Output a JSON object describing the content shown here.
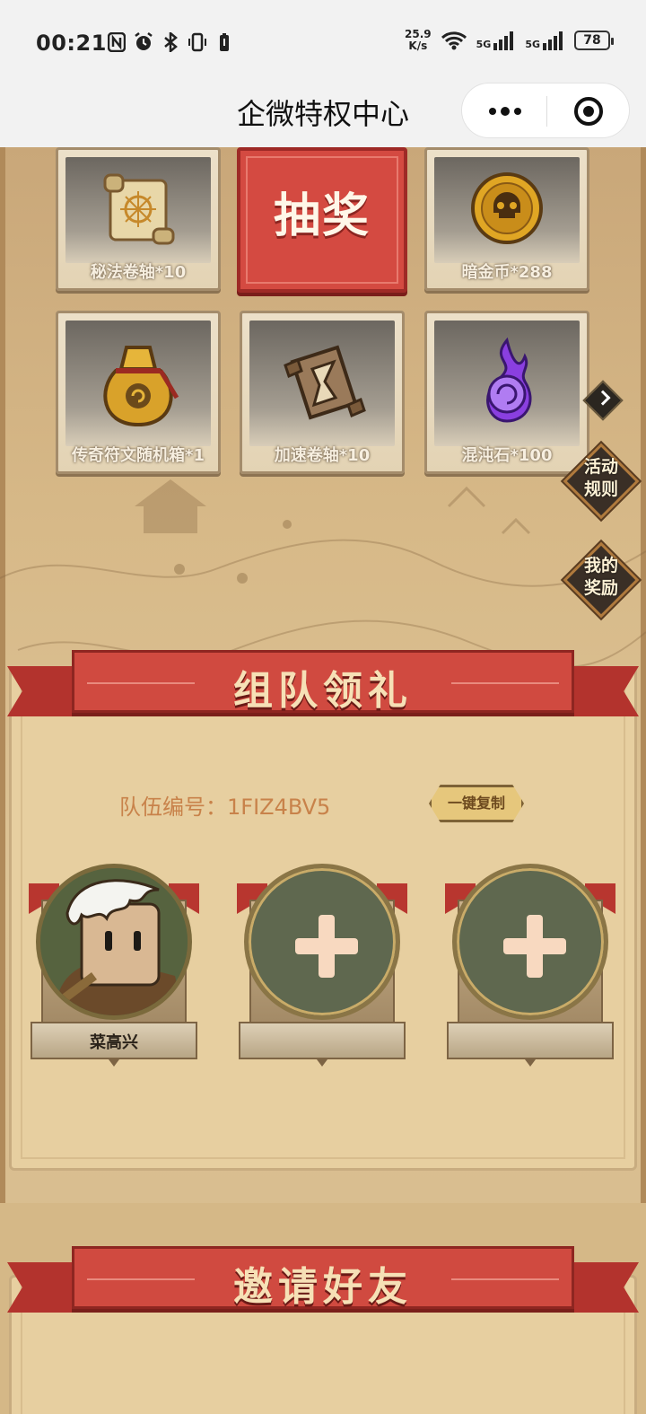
{
  "status_bar": {
    "time": "00:21",
    "speed_value": "25.9",
    "speed_unit": "K/s",
    "network_1": "5G",
    "network_2": "5G",
    "battery": "78"
  },
  "title_bar": {
    "title": "企微特权中心"
  },
  "rewards": {
    "draw_label": "抽奖",
    "items": [
      {
        "label": "秘法卷轴*10",
        "icon": "scroll-icon"
      },
      {
        "label": "暗金币*288",
        "icon": "skull-coin-icon"
      },
      {
        "label": "传奇符文随机箱*1",
        "icon": "rune-bag-icon"
      },
      {
        "label": "加速卷轴*10",
        "icon": "hourglass-scroll-icon"
      },
      {
        "label": "混沌石*100",
        "icon": "chaos-stone-icon"
      }
    ]
  },
  "side_buttons": {
    "rules_line1": "活动",
    "rules_line2": "规则",
    "rewards_line1": "我的",
    "rewards_line2": "奖励"
  },
  "team": {
    "title": "组队领礼",
    "code_label": "队伍编号：",
    "code_value": "1FIZ4BV5",
    "copy_label": "一键复制",
    "members": [
      {
        "name": "菜高兴",
        "filled": true
      },
      {
        "name": "",
        "filled": false
      },
      {
        "name": "",
        "filled": false
      }
    ]
  },
  "invite": {
    "title": "邀请好友"
  },
  "colors": {
    "ribbon_red": "#d04a40",
    "draw_red": "#d44a41",
    "slot_green": "#5f684f",
    "code_text": "#c8824a"
  }
}
